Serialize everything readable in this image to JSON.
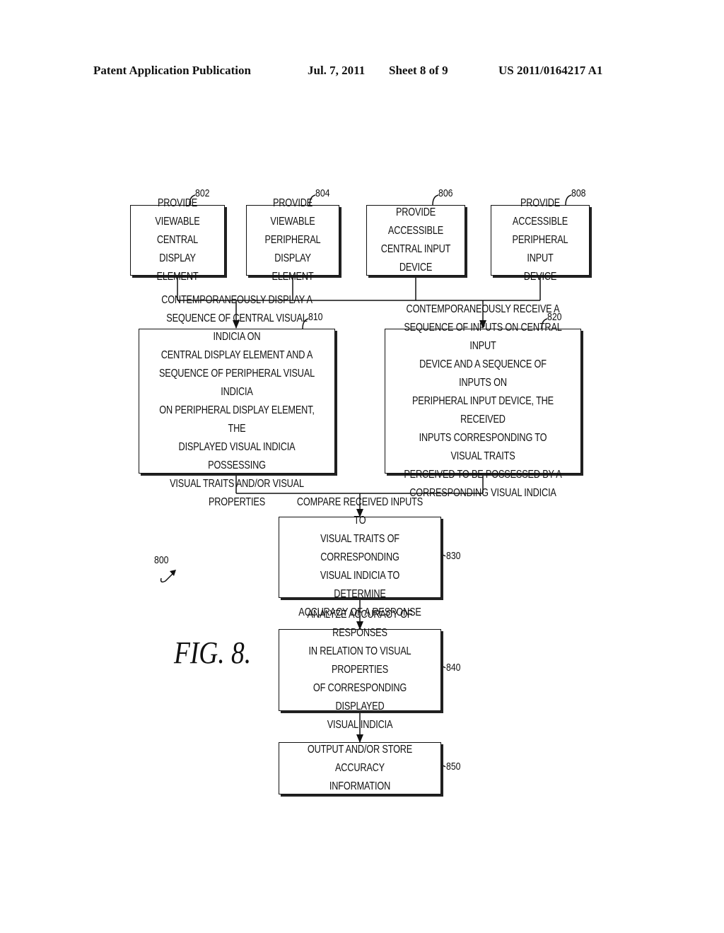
{
  "header": {
    "publication": "Patent Application Publication",
    "date": "Jul. 7, 2011",
    "sheet": "Sheet 8 of 9",
    "number": "US 2011/0164217 A1"
  },
  "figure": {
    "label": "FIG. 8.",
    "reference": "800"
  },
  "steps": [
    {
      "ref": "802",
      "text": "PROVIDE VIEWABLE\nCENTRAL DISPLAY\nELEMENT"
    },
    {
      "ref": "804",
      "text": "PROVIDE VIEWABLE\nPERIPHERAL\nDISPLAY ELEMENT"
    },
    {
      "ref": "806",
      "text": "PROVIDE ACCESSIBLE\nCENTRAL INPUT\nDEVICE"
    },
    {
      "ref": "808",
      "text": "PROVIDE ACCESSIBLE\nPERIPHERAL INPUT\nDEVICE"
    },
    {
      "ref": "810",
      "text": "CONTEMPORANEOUSLY DISPLAY A\nSEQUENCE OF CENTRAL VISUAL INDICIA ON\nCENTRAL DISPLAY ELEMENT AND A\nSEQUENCE OF PERIPHERAL VISUAL INDICIA\nON PERIPHERAL DISPLAY ELEMENT, THE\nDISPLAYED VISUAL INDICIA POSSESSING\nVISUAL TRAITS AND/OR VISUAL PROPERTIES"
    },
    {
      "ref": "820",
      "text": "CONTEMPORANEOUSLY RECEIVE A\nSEQUENCE OF INPUTS ON CENTRAL INPUT\nDEVICE AND A SEQUENCE OF INPUTS ON\nPERIPHERAL INPUT DEVICE, THE RECEIVED\nINPUTS CORRESPONDING TO VISUAL TRAITS\nPERCEIVED TO BE POSSESSED BY A\nCORRESPONDING VISUAL INDICIA"
    },
    {
      "ref": "830",
      "text": "COMPARE RECEIVED INPUTS TO\nVISUAL TRAITS OF CORRESPONDING\nVISUAL INDICIA TO DETERMINE\nACCURACY OF A RESPONSE"
    },
    {
      "ref": "840",
      "text": "ANALYZE ACCURACY OF RESPONSES\nIN RELATION TO VISUAL PROPERTIES\nOF CORRESPONDING DISPLAYED\nVISUAL INDICIA"
    },
    {
      "ref": "850",
      "text": "OUTPUT AND/OR STORE ACCURACY\nINFORMATION"
    }
  ]
}
